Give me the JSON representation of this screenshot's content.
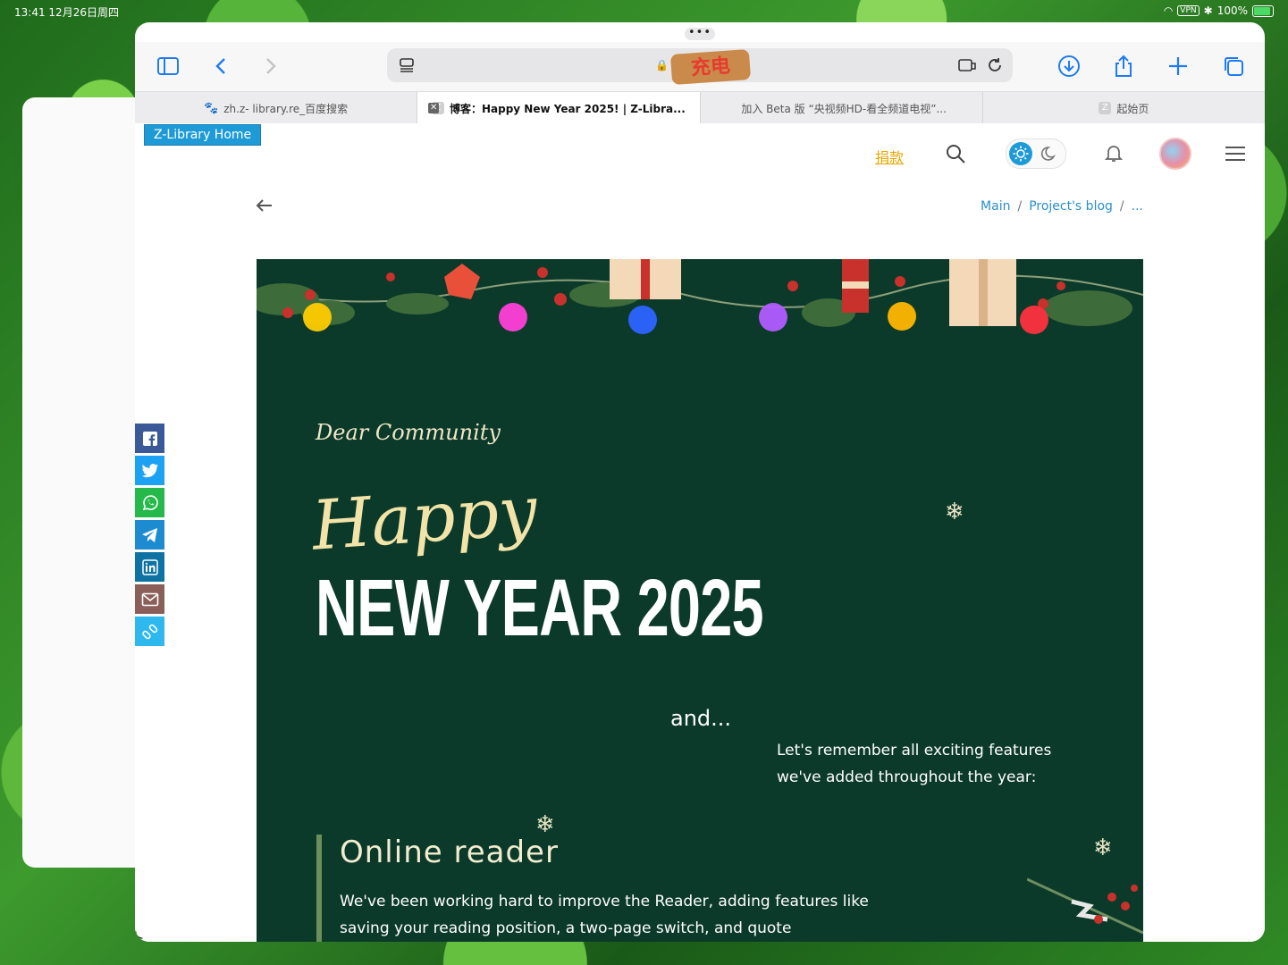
{
  "statusbar": {
    "time": "13:41",
    "date": "12月26日周四",
    "vpn": "VPN",
    "battery": "100%"
  },
  "toolbar": {
    "sticker": "充电"
  },
  "tabs": [
    {
      "label": "zh.z- library.re_百度搜索"
    },
    {
      "label": "博客：Happy New Year 2025! | Z-Libra..."
    },
    {
      "label": "加入 Beta 版 “央视频HD-看全频道电视”..."
    },
    {
      "label": "起始页"
    }
  ],
  "page": {
    "home_label": "Z-Library Home",
    "donate": "捐款",
    "breadcrumbs": [
      "Main",
      "Project's blog",
      "..."
    ]
  },
  "banner": {
    "dear": "Dear Community",
    "happy": "Happy",
    "headline": "NEW YEAR 2025",
    "and": "and...",
    "remember": "Let's remember all exciting features we've added throughout the year:",
    "section_title": "Online reader",
    "section_text": "We've been working hard to improve the Reader, adding features like saving your reading position, a two-page switch, and quote"
  },
  "colors": {
    "accent": "#1e9bd7",
    "banner_bg": "#0c3a2a",
    "donate": "#e8a700",
    "safari_blue": "#1f7bf2"
  }
}
